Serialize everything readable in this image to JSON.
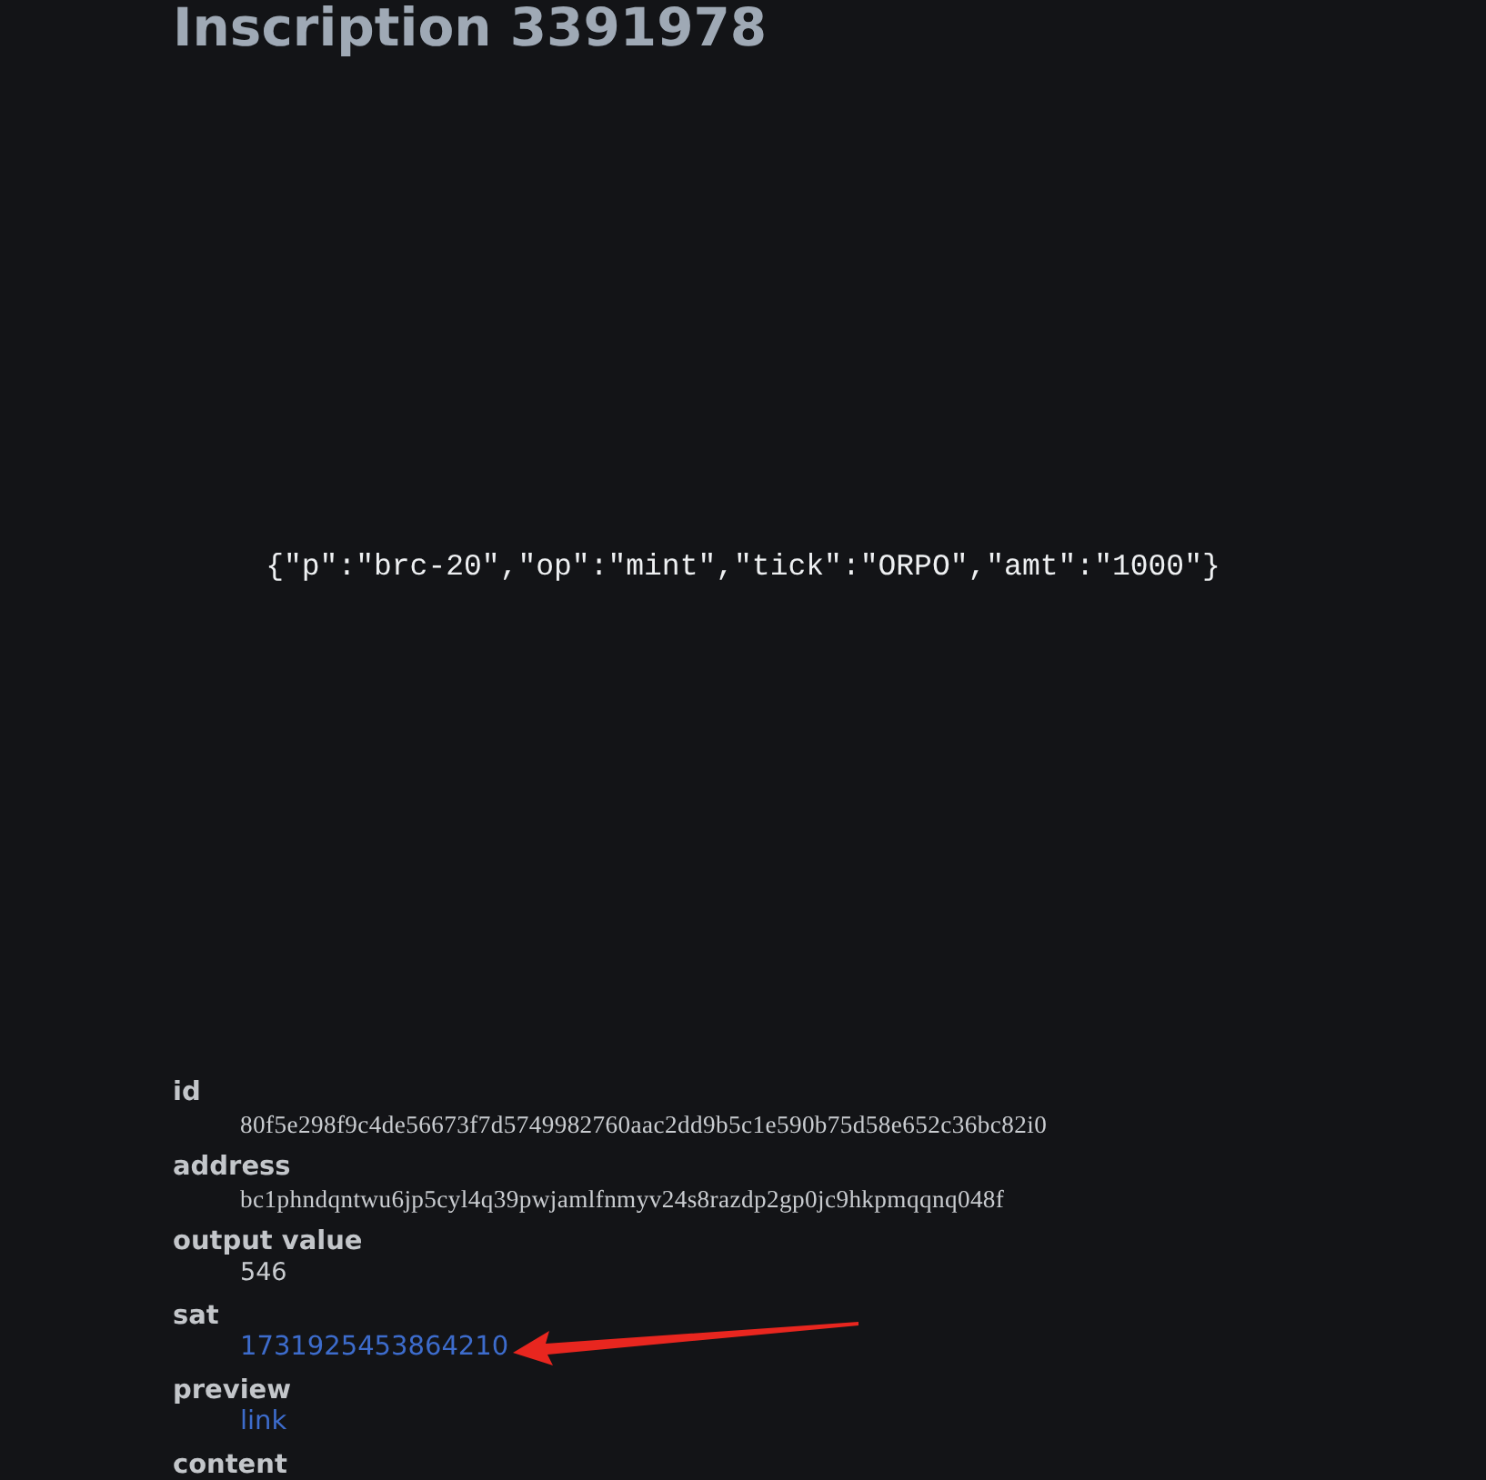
{
  "title": "Inscription 3391978",
  "preview": {
    "content": "{\"p\":\"brc-20\",\"op\":\"mint\",\"tick\":\"ORPO\",\"amt\":\"1000\"}"
  },
  "details": [
    {
      "term": "id",
      "description": "80f5e298f9c4de56673f7d5749982760aac2dd9b5c1e590b75d58e652c36bc82i0",
      "kind": "mono"
    },
    {
      "term": "address",
      "description": "bc1phndqntwu6jp5cyl4q39pwjamlfnmyv24s8razdp2gp0jc9hkpmqqnq048f",
      "kind": "mono"
    },
    {
      "term": "output value",
      "description": "546",
      "kind": "text"
    },
    {
      "term": "sat",
      "description": "1731925453864210",
      "kind": "link"
    },
    {
      "term": "preview",
      "description": "link",
      "kind": "link"
    },
    {
      "term": "content",
      "kind": "heading"
    }
  ]
}
